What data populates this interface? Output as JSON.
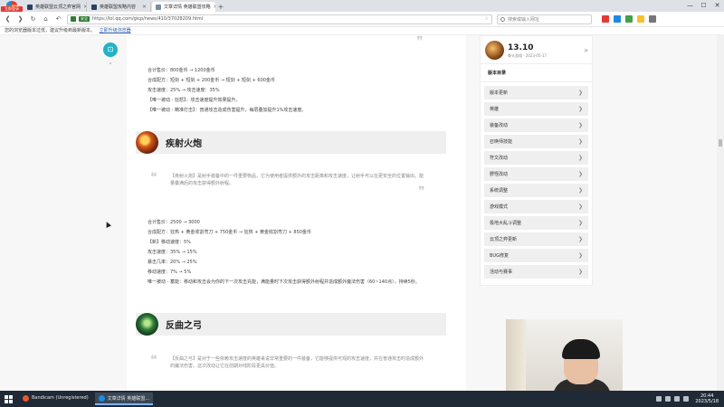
{
  "browser": {
    "logo_label": "立即登录",
    "tabs": [
      {
        "title": "英雄联盟云顶之弈官网",
        "active": false
      },
      {
        "title": "英雄联盟攻略内容",
        "active": false
      },
      {
        "title": "文章详情 英雄联盟攻略",
        "active": true
      }
    ],
    "new_tab": "+",
    "window_controls": [
      "—",
      "☐",
      "✕"
    ],
    "url": "https://lol.qq.com/gicp/news/410/37028209.html",
    "secure_tag": "安全",
    "search_placeholder": "搜索或输入网址"
  },
  "notice_bar": {
    "text": "您的浏览器版本过低，建议升级到最新版本。",
    "link": "立即升级浏览器"
  },
  "article": {
    "stats_block_1": [
      "合计售价：800金币 → 1200金币",
      "合成配方：短剑 + 短剑 + 200金币 → 短剑 + 短剑 + 600金币",
      "攻击速度：25% → 攻击速度：35%",
      "【唯一被动 - 狂怒】：攻击速度提升效果提升。",
      "【唯一被动 - 精准打击】：普通攻击造成伤害提升，每层叠加提升1%攻击速度。"
    ],
    "items": [
      {
        "name": "疾射火炮",
        "icon": "rapid-firecannon-icon",
        "quote": "【疾射火炮】是射手装备中的一件重要物品，它为使用者提供额外的攻击距离和攻击速度，让射手可以在更安全的位置输出。能量叠满后的攻击获得额外射程。",
        "stats": [
          "合计售价：2500 → 3000",
          "合成配方：狂热 + 黄金收割弯刀 + 750金币 → 狂热 + 黄金收割弯刀 + 850金币",
          "【新】移动速度：5%",
          "攻击速度：35% → 15%",
          "暴击几率：20% → 25%",
          "移动速度：7% → 5%",
          "唯一被动 - 蓄能：移动和攻击会为你的下一次攻击充能，满能量时下次攻击获得额外射程并造成额外魔法伤害（60~140点），持续5秒。"
        ]
      },
      {
        "name": "反曲之弓",
        "icon": "recurve-bow-icon",
        "quote": "【反曲之弓】是对于一些依赖攻击速度的英雄来说非常重要的一件装备，它能够提供可观的攻击速度，并在普通攻击时造成额外的魔法伤害。这次改动让它在前期对线阶段更具价值。"
      }
    ]
  },
  "sidebar": {
    "patch": {
      "version": "13.10",
      "meta": "拳头游戏 · 2023-05-17"
    },
    "menu_title": "版本目录",
    "menu_items": [
      "版本更新",
      "英雄",
      "装备改动",
      "召唤师技能",
      "符文改动",
      "野怪改动",
      "系统调整",
      "游戏模式",
      "极地大乱斗调整",
      "云顶之弈更新",
      "BUG修复",
      "活动与赛事"
    ]
  },
  "taskbar": {
    "tasks": [
      {
        "title": "Bandicam (Unregistered)",
        "color": "#e55a2b",
        "active": false
      },
      {
        "title": "文章详情 英雄联盟...",
        "color": "#1e88e5",
        "active": true
      }
    ],
    "time": "20:44",
    "date": "2023/5/18"
  }
}
